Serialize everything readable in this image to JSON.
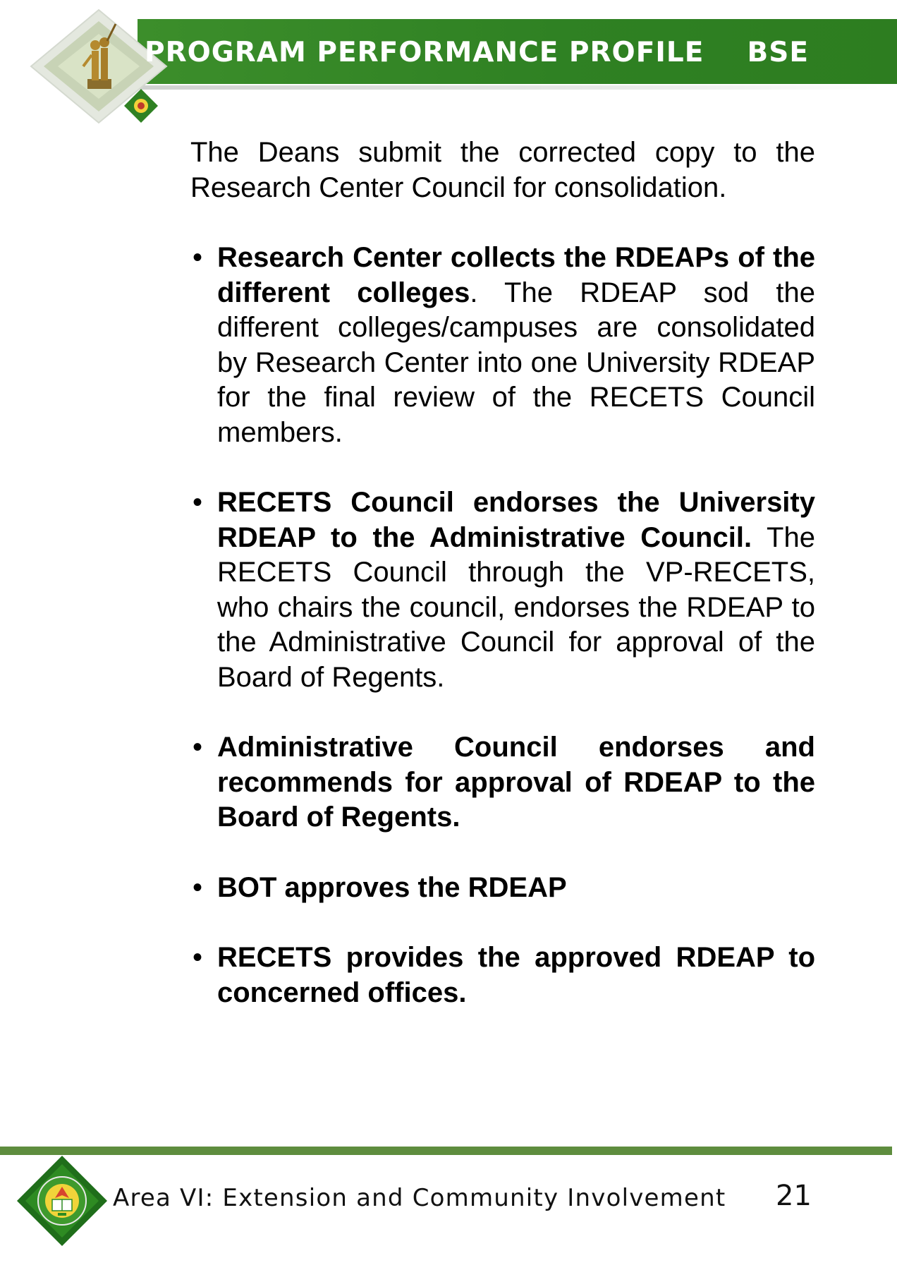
{
  "header": {
    "title": "PROGRAM PERFORMANCE PROFILE",
    "program_code": "BSE",
    "accent_color": "#2f8123"
  },
  "intro_text": "The Deans submit the corrected copy to the Research Center Council for consolidation.",
  "steps": [
    {
      "bold": "Research Center collects the RDEAPs of the different colleges",
      "text": ".  The RDEAP sod the different colleges/campuses are consolidated by Research Center into one University RDEAP for the final review of the RECETS Council members."
    },
    {
      "bold": "RECETS Council endorses the University RDEAP to the Administrative Council.",
      "text": " The RECETS Council through the VP-RECETS, who chairs the council, endorses the RDEAP to the Administrative Council for approval of the Board of Regents."
    },
    {
      "bold": "Administrative Council endorses and recommends for approval of RDEAP to the Board of Regents.",
      "text": ""
    },
    {
      "bold": "BOT approves the RDEAP",
      "text": ""
    },
    {
      "bold": "RECETS provides the approved RDEAP to concerned offices.",
      "text": ""
    }
  ],
  "footer": {
    "area_label": "Area VI: Extension and Community Involvement",
    "page_number": "21",
    "rule_color": "#5e8d3e"
  },
  "icons": {
    "header_logo": "university-statue-logo-icon",
    "footer_logo": "university-seal-icon",
    "bullet": "bullet-dot-icon"
  }
}
